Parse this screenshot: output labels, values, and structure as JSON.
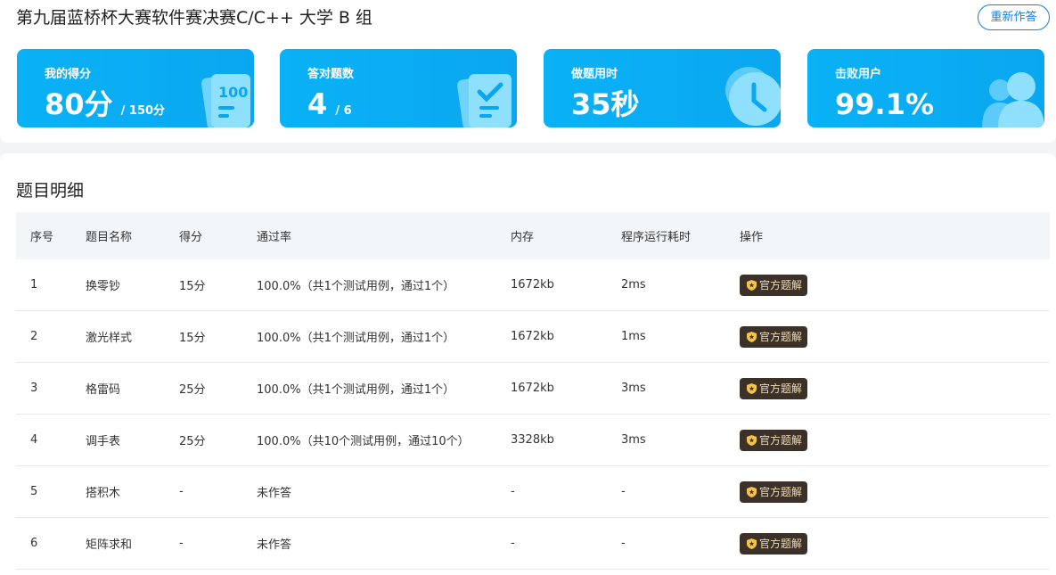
{
  "header": {
    "title": "第九届蓝桥杯大赛软件赛决赛C/C++ 大学 B 组",
    "redo_label": "重新作答"
  },
  "stats": [
    {
      "label": "我的得分",
      "value": "80分",
      "suffix": "/ 150分",
      "icon": "score-sheet-icon"
    },
    {
      "label": "答对题数",
      "value": "4",
      "suffix": "/ 6",
      "icon": "checklist-icon"
    },
    {
      "label": "做题用时",
      "value": "35秒",
      "suffix": "",
      "icon": "clock-icon"
    },
    {
      "label": "击败用户",
      "value": "99.1%",
      "suffix": "",
      "icon": "users-icon"
    }
  ],
  "details": {
    "title": "题目明细",
    "columns": [
      "序号",
      "题目名称",
      "得分",
      "通过率",
      "内存",
      "程序运行耗时",
      "操作"
    ],
    "rows": [
      {
        "no": "1",
        "name": "换零钞",
        "score": "15分",
        "pass": "100.0%（共1个测试用例，通过1个）",
        "memory": "1672kb",
        "time": "2ms",
        "action": "官方题解"
      },
      {
        "no": "2",
        "name": "激光样式",
        "score": "15分",
        "pass": "100.0%（共1个测试用例，通过1个）",
        "memory": "1672kb",
        "time": "1ms",
        "action": "官方题解"
      },
      {
        "no": "3",
        "name": "格雷码",
        "score": "25分",
        "pass": "100.0%（共1个测试用例，通过1个）",
        "memory": "1672kb",
        "time": "3ms",
        "action": "官方题解"
      },
      {
        "no": "4",
        "name": "调手表",
        "score": "25分",
        "pass": "100.0%（共10个测试用例，通过10个）",
        "memory": "3328kb",
        "time": "3ms",
        "action": "官方题解"
      },
      {
        "no": "5",
        "name": "搭积木",
        "score": "-",
        "pass": "未作答",
        "memory": "-",
        "time": "-",
        "action": "官方题解"
      },
      {
        "no": "6",
        "name": "矩阵求和",
        "score": "-",
        "pass": "未作答",
        "memory": "-",
        "time": "-",
        "action": "官方题解"
      }
    ]
  },
  "colors": {
    "card_blue": "#0ab1f5",
    "accent_blue": "#1a7fe0",
    "solution_bg": "#3b3128",
    "solution_text": "#f0dcb4"
  }
}
